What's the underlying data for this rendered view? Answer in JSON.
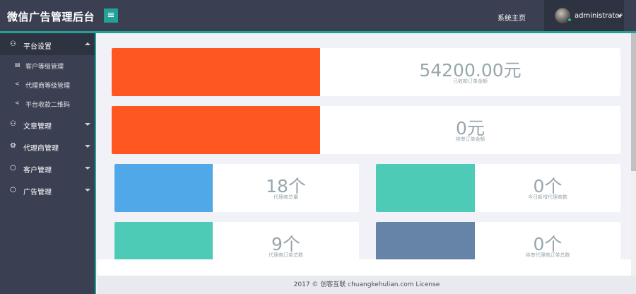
{
  "header": {
    "brand": "微信广告管理后台",
    "menu_toggle_icon": "≡",
    "home_link": "系统主页",
    "username": "administrator"
  },
  "colors": {
    "header_bg": "#3a3f51",
    "accent": "#1fa195",
    "orange": "#ff5722",
    "blue": "#51a8e8",
    "teal": "#4ecbb6",
    "slate": "#6584a8"
  },
  "sidebar": {
    "groups": [
      {
        "label": "平台设置",
        "icon": "sitemap-icon",
        "glyph": "⚇",
        "expanded": true
      },
      {
        "label": "文章管理",
        "icon": "sitemap-icon",
        "glyph": "⚇",
        "expanded": false
      },
      {
        "label": "代理商管理",
        "icon": "cogs-icon",
        "glyph": "⚙",
        "expanded": false
      },
      {
        "label": "客户管理",
        "icon": "refresh-icon",
        "glyph": "○",
        "expanded": false
      },
      {
        "label": "广告管理",
        "icon": "refresh-icon",
        "glyph": "○",
        "expanded": false
      }
    ],
    "sub_items": [
      {
        "label": "客户等级管理",
        "icon": "list-icon",
        "glyph": "▤"
      },
      {
        "label": "代理商等级管理",
        "icon": "share-icon",
        "glyph": "<"
      },
      {
        "label": "平台收款二维码",
        "icon": "share-icon",
        "glyph": "<"
      }
    ]
  },
  "stats": {
    "received_amount": {
      "value": "54200.00元",
      "label": "已收款订单金额"
    },
    "pending_amount": {
      "value": "0元",
      "label": "待审订单金额"
    },
    "agent_total": {
      "value": "18个",
      "label": "代理商总量"
    },
    "new_agents_today": {
      "value": "0个",
      "label": "今日新增代理商数"
    },
    "agent_orders": {
      "value": "9个",
      "label": "代理商订单总数"
    },
    "pending_agent_orders": {
      "value": "0个",
      "label": "待审代理商订单总数"
    }
  },
  "footer": {
    "text": "2017 ©  创客互联 chuangkehulian.com License"
  }
}
